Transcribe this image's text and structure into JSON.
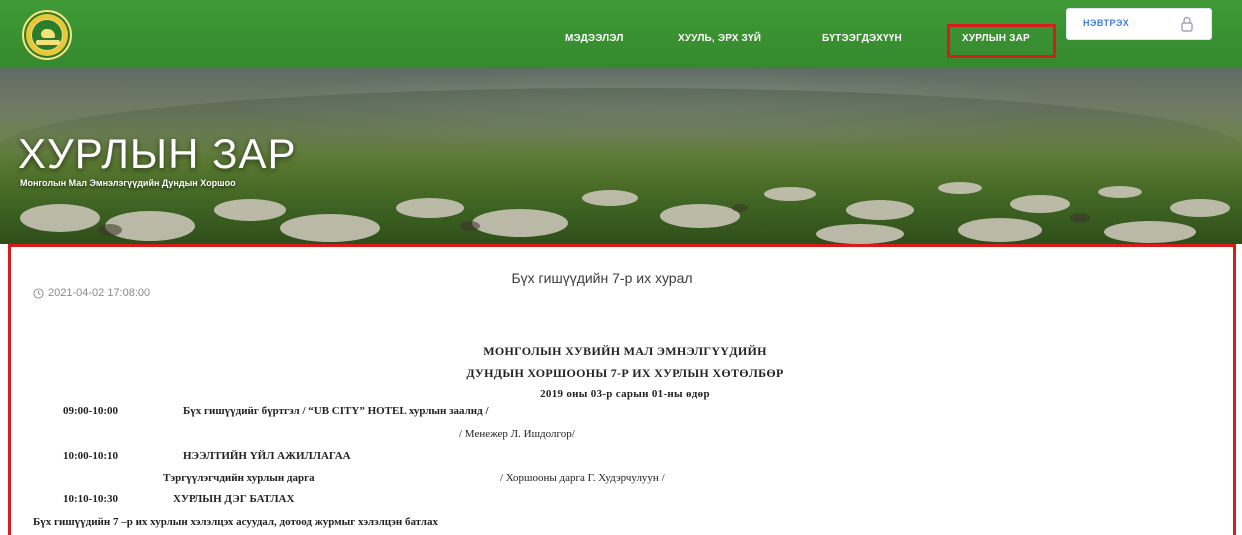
{
  "nav": {
    "items": [
      "МЭДЭЭЛЭЛ",
      "ХУУЛЬ, ЭРХ ЗҮЙ",
      "БҮТЭЭГДЭХҮҮН",
      "ХУРЛЫН ЗАР"
    ],
    "active_index": 3,
    "login_label": "НЭВТРЭХ"
  },
  "hero": {
    "title": "ХУРЛЫН ЗАР",
    "subtitle": "Монголын Мал Эмнэлэгүүдийн Дундын Хоршоо"
  },
  "post": {
    "title": "Бүх гишүүдийн 7-р их хурал",
    "date": "2021-04-02 17:08:00"
  },
  "document": {
    "heading_1": "МОНГОЛЫН ХУВИЙН МАЛ ЭМНЭЛГҮҮДИЙН",
    "heading_2": "ДУНДЫН ХОРШООНЫ 7-Р ИХ ХУРЛЫН ХӨТӨЛБӨР",
    "heading_3": "2019 оны 03-р сарын 01-ны өдөр",
    "row1_time": "09:00-10:00",
    "row1_text": "Бүх гишүүдийг бүртгэл / “UB CITY” HOTEL хурлын заалнд /",
    "row1_person": "/ Менежер Л. Ишдолгор/",
    "row2_time": "10:00-10:10",
    "row2_text": "НЭЭЛТИЙН ҮЙЛ АЖИЛЛАГАА",
    "row2_role": "Тэргүүлэгчдийн хурлын дарга",
    "row2_person": "/ Хоршооны дарга Г. Худэрчулуун /",
    "row3_time": "10:10-10:30",
    "row3_text": "ХУРЛЫН ДЭГ БАТЛАХ",
    "row4_text": "Бүх гишүүдийн 7 –р их хурлын хэлэлцэх асуудал, дотоод журмыг хэлэлцэн батлах"
  },
  "colors": {
    "nav_green": "#3f9a36",
    "highlight_red": "#d81b1b",
    "login_blue": "#3f7be0"
  }
}
